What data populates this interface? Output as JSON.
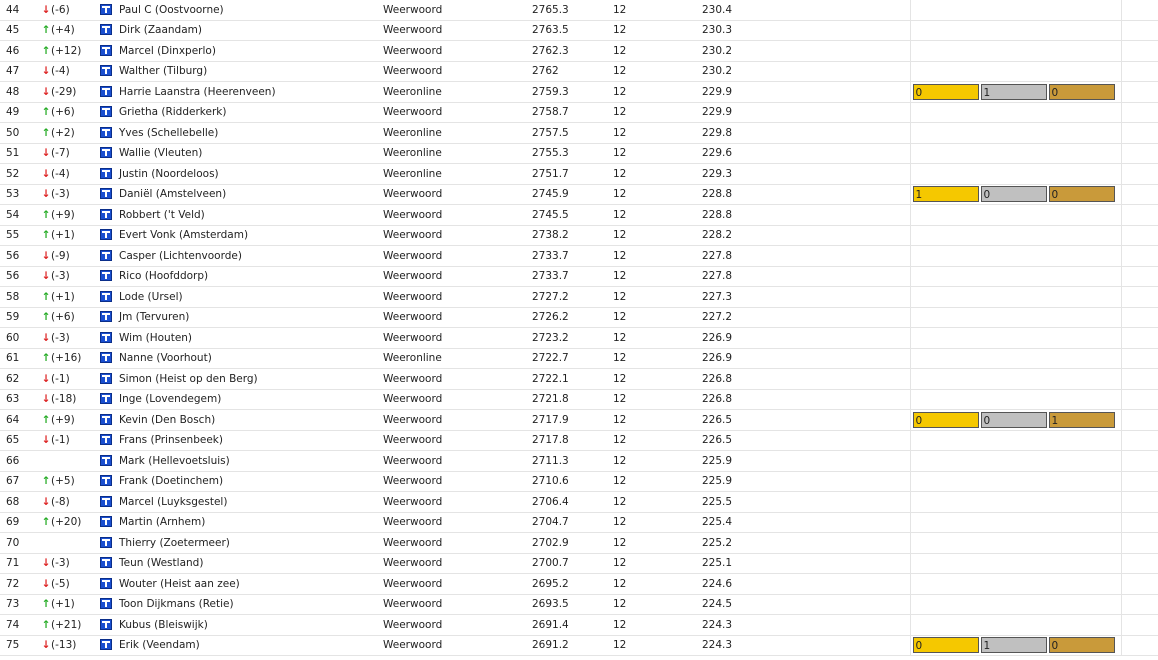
{
  "colors": {
    "up": "#22aa22",
    "down": "#dd2222",
    "gold": "#f5c800",
    "silver": "#c0c0c0",
    "bronze": "#c99a3a"
  },
  "icons": {
    "arrow_up": "↑",
    "arrow_down": "↓",
    "team": "team-icon"
  },
  "rows": [
    {
      "rank": "44",
      "dir": "down",
      "change": "(-6)",
      "name": "Paul C (Oostvoorne)",
      "source": "Weerwoord",
      "score": "2765.3",
      "n": "12",
      "avg": "230.4"
    },
    {
      "rank": "45",
      "dir": "up",
      "change": "(+4)",
      "name": "Dirk (Zaandam)",
      "source": "Weerwoord",
      "score": "2763.5",
      "n": "12",
      "avg": "230.3"
    },
    {
      "rank": "46",
      "dir": "up",
      "change": "(+12)",
      "name": "Marcel (Dinxperlo)",
      "source": "Weerwoord",
      "score": "2762.3",
      "n": "12",
      "avg": "230.2"
    },
    {
      "rank": "47",
      "dir": "down",
      "change": "(-4)",
      "name": "Walther (Tilburg)",
      "source": "Weerwoord",
      "score": "2762",
      "n": "12",
      "avg": "230.2"
    },
    {
      "rank": "48",
      "dir": "down",
      "change": "(-29)",
      "name": "Harrie Laanstra (Heerenveen)",
      "source": "Weeronline",
      "score": "2759.3",
      "n": "12",
      "avg": "229.9",
      "medals": [
        "0",
        "1",
        "0"
      ]
    },
    {
      "rank": "49",
      "dir": "up",
      "change": "(+6)",
      "name": "Grietha (Ridderkerk)",
      "source": "Weerwoord",
      "score": "2758.7",
      "n": "12",
      "avg": "229.9"
    },
    {
      "rank": "50",
      "dir": "up",
      "change": "(+2)",
      "name": "Yves (Schellebelle)",
      "source": "Weeronline",
      "score": "2757.5",
      "n": "12",
      "avg": "229.8"
    },
    {
      "rank": "51",
      "dir": "down",
      "change": "(-7)",
      "name": "Wallie (Vleuten)",
      "source": "Weeronline",
      "score": "2755.3",
      "n": "12",
      "avg": "229.6"
    },
    {
      "rank": "52",
      "dir": "down",
      "change": "(-4)",
      "name": "Justin (Noordeloos)",
      "source": "Weeronline",
      "score": "2751.7",
      "n": "12",
      "avg": "229.3"
    },
    {
      "rank": "53",
      "dir": "down",
      "change": "(-3)",
      "name": "Daniël (Amstelveen)",
      "source": "Weerwoord",
      "score": "2745.9",
      "n": "12",
      "avg": "228.8",
      "medals": [
        "1",
        "0",
        "0"
      ]
    },
    {
      "rank": "54",
      "dir": "up",
      "change": "(+9)",
      "name": "Robbert ('t Veld)",
      "source": "Weerwoord",
      "score": "2745.5",
      "n": "12",
      "avg": "228.8"
    },
    {
      "rank": "55",
      "dir": "up",
      "change": "(+1)",
      "name": "Evert Vonk (Amsterdam)",
      "source": "Weerwoord",
      "score": "2738.2",
      "n": "12",
      "avg": "228.2"
    },
    {
      "rank": "56",
      "dir": "down",
      "change": "(-9)",
      "name": "Casper (Lichtenvoorde)",
      "source": "Weerwoord",
      "score": "2733.7",
      "n": "12",
      "avg": "227.8"
    },
    {
      "rank": "56",
      "dir": "down",
      "change": "(-3)",
      "name": "Rico (Hoofddorp)",
      "source": "Weerwoord",
      "score": "2733.7",
      "n": "12",
      "avg": "227.8"
    },
    {
      "rank": "58",
      "dir": "up",
      "change": "(+1)",
      "name": "Lode (Ursel)",
      "source": "Weerwoord",
      "score": "2727.2",
      "n": "12",
      "avg": "227.3"
    },
    {
      "rank": "59",
      "dir": "up",
      "change": "(+6)",
      "name": "Jm (Tervuren)",
      "source": "Weerwoord",
      "score": "2726.2",
      "n": "12",
      "avg": "227.2"
    },
    {
      "rank": "60",
      "dir": "down",
      "change": "(-3)",
      "name": "Wim (Houten)",
      "source": "Weerwoord",
      "score": "2723.2",
      "n": "12",
      "avg": "226.9"
    },
    {
      "rank": "61",
      "dir": "up",
      "change": "(+16)",
      "name": "Nanne (Voorhout)",
      "source": "Weeronline",
      "score": "2722.7",
      "n": "12",
      "avg": "226.9"
    },
    {
      "rank": "62",
      "dir": "down",
      "change": "(-1)",
      "name": "Simon (Heist op den Berg)",
      "source": "Weerwoord",
      "score": "2722.1",
      "n": "12",
      "avg": "226.8"
    },
    {
      "rank": "63",
      "dir": "down",
      "change": "(-18)",
      "name": "Inge (Lovendegem)",
      "source": "Weerwoord",
      "score": "2721.8",
      "n": "12",
      "avg": "226.8"
    },
    {
      "rank": "64",
      "dir": "up",
      "change": "(+9)",
      "name": "Kevin (Den Bosch)",
      "source": "Weerwoord",
      "score": "2717.9",
      "n": "12",
      "avg": "226.5",
      "medals": [
        "0",
        "0",
        "1"
      ]
    },
    {
      "rank": "65",
      "dir": "down",
      "change": "(-1)",
      "name": "Frans (Prinsenbeek)",
      "source": "Weerwoord",
      "score": "2717.8",
      "n": "12",
      "avg": "226.5"
    },
    {
      "rank": "66",
      "dir": "",
      "change": "",
      "name": "Mark (Hellevoetsluis)",
      "source": "Weerwoord",
      "score": "2711.3",
      "n": "12",
      "avg": "225.9"
    },
    {
      "rank": "67",
      "dir": "up",
      "change": "(+5)",
      "name": "Frank (Doetinchem)",
      "source": "Weerwoord",
      "score": "2710.6",
      "n": "12",
      "avg": "225.9"
    },
    {
      "rank": "68",
      "dir": "down",
      "change": "(-8)",
      "name": "Marcel (Luyksgestel)",
      "source": "Weerwoord",
      "score": "2706.4",
      "n": "12",
      "avg": "225.5"
    },
    {
      "rank": "69",
      "dir": "up",
      "change": "(+20)",
      "name": "Martin (Arnhem)",
      "source": "Weerwoord",
      "score": "2704.7",
      "n": "12",
      "avg": "225.4"
    },
    {
      "rank": "70",
      "dir": "",
      "change": "",
      "name": "Thierry (Zoetermeer)",
      "source": "Weerwoord",
      "score": "2702.9",
      "n": "12",
      "avg": "225.2"
    },
    {
      "rank": "71",
      "dir": "down",
      "change": "(-3)",
      "name": "Teun (Westland)",
      "source": "Weerwoord",
      "score": "2700.7",
      "n": "12",
      "avg": "225.1"
    },
    {
      "rank": "72",
      "dir": "down",
      "change": "(-5)",
      "name": "Wouter (Heist aan zee)",
      "source": "Weerwoord",
      "score": "2695.2",
      "n": "12",
      "avg": "224.6"
    },
    {
      "rank": "73",
      "dir": "up",
      "change": "(+1)",
      "name": "Toon Dijkmans (Retie)",
      "source": "Weerwoord",
      "score": "2693.5",
      "n": "12",
      "avg": "224.5"
    },
    {
      "rank": "74",
      "dir": "up",
      "change": "(+21)",
      "name": "Kubus (Bleiswijk)",
      "source": "Weerwoord",
      "score": "2691.4",
      "n": "12",
      "avg": "224.3"
    },
    {
      "rank": "75",
      "dir": "down",
      "change": "(-13)",
      "name": "Erik (Veendam)",
      "source": "Weerwoord",
      "score": "2691.2",
      "n": "12",
      "avg": "224.3",
      "medals": [
        "0",
        "1",
        "0"
      ]
    }
  ]
}
